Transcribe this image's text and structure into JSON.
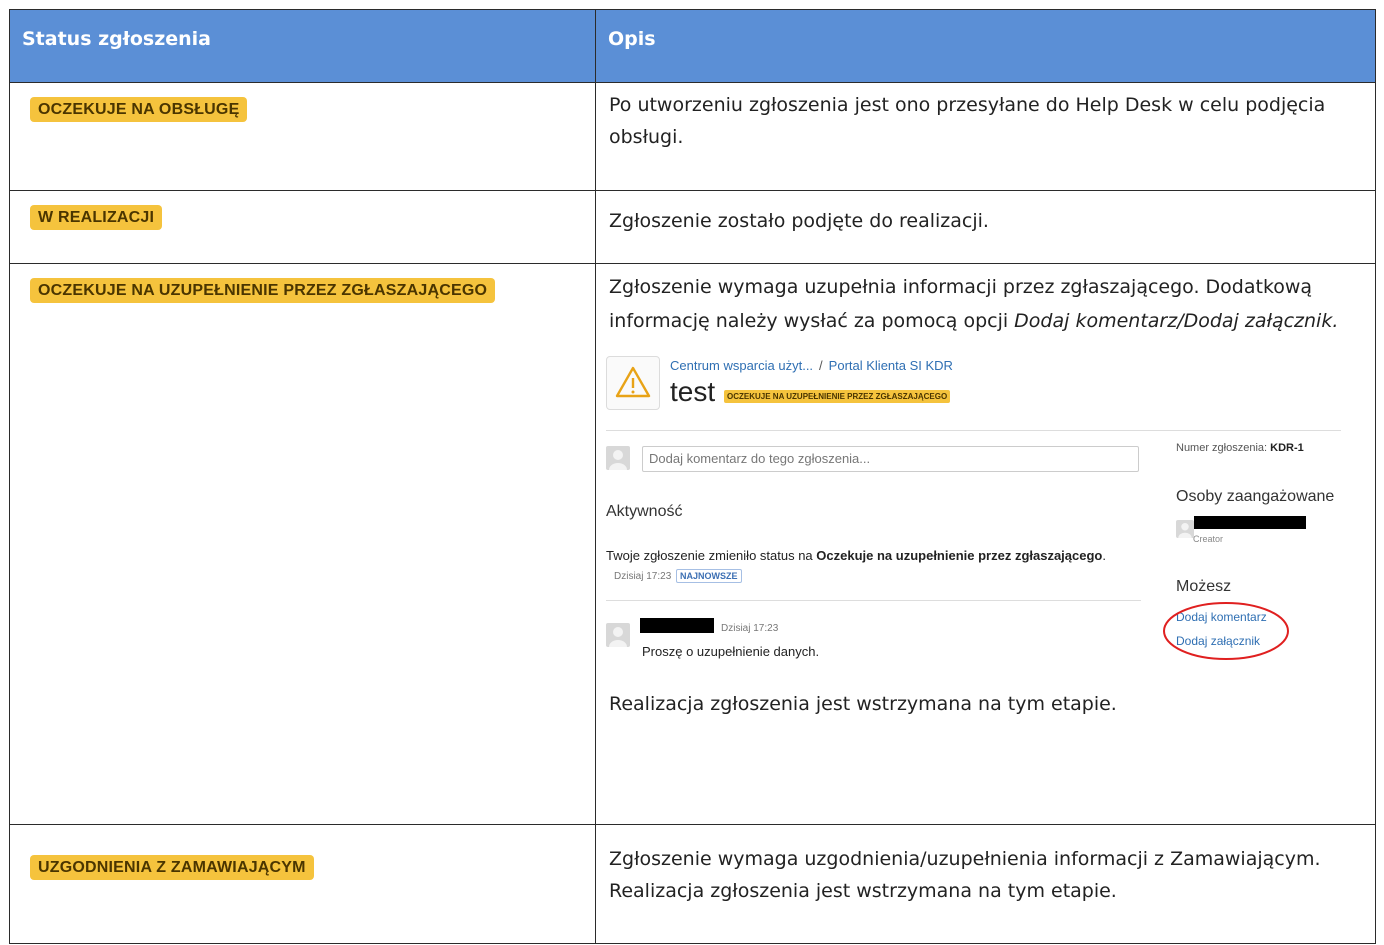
{
  "header": {
    "col1": "Status zgłoszenia",
    "col2": "Opis"
  },
  "rows": [
    {
      "badge": "OCZEKUJE NA OBSŁUGĘ",
      "desc": "Po utworzeniu zgłoszenia jest ono przesyłane do Help Desk w celu podjęcia obsługi."
    },
    {
      "badge": "W REALIZACJI",
      "desc": "Zgłoszenie zostało podjęte do realizacji."
    },
    {
      "badge": "OCZEKUJE NA UZUPEŁNIENIE PRZEZ ZGŁASZAJĄCEGO",
      "desc_plain": "Zgłoszenie wymaga uzupełnia informacji przez zgłaszającego. Dodatkową informację należy wysłać za pomocą opcji ",
      "desc_italic": "Dodaj komentarz/Dodaj załącznik.",
      "after": "Realizacja zgłoszenia jest wstrzymana na tym etapie."
    },
    {
      "badge": "UZGODNIENIA Z ZAMAWIAJĄCYM",
      "desc": "Zgłoszenie wymaga uzgodnienia/uzupełnienia informacji z Zamawiającym. Realizacja zgłoszenia jest wstrzymana na tym etapie."
    }
  ],
  "shot": {
    "crumb1": "Centrum wsparcia użyt...",
    "crumb_sep": "/",
    "crumb2": "Portal Klienta SI KDR",
    "title": "test",
    "title_badge": "OCZEKUJE NA UZUPEŁNIENIE PRZEZ ZGŁASZAJĄCEGO",
    "comment_placeholder": "Dodaj komentarz do tego zgłoszenia...",
    "activity_label": "Aktywność",
    "status_prefix": "Twoje zgłoszenie zmieniło status na ",
    "status_bold": "Oczekuje na uzupełnienie przez zgłaszającego",
    "status_suffix": ".",
    "time1": "Dzisiaj 17:23",
    "newest": "NAJNOWSZE",
    "time2": "Dzisiaj 17:23",
    "comment": "Proszę o uzupełnienie danych.",
    "number_label": "Numer zgłoszenia: ",
    "number_value": "KDR-1",
    "involved_label": "Osoby zaangażowane",
    "creator": "Creator",
    "can_label": "Możesz",
    "link_comment": "Dodaj komentarz",
    "link_attach": "Dodaj załącznik",
    "colors": {
      "badge": "#f5c33d",
      "header": "#5b8fd6",
      "link": "#2f6fb3",
      "ellipse": "#e02020"
    }
  }
}
